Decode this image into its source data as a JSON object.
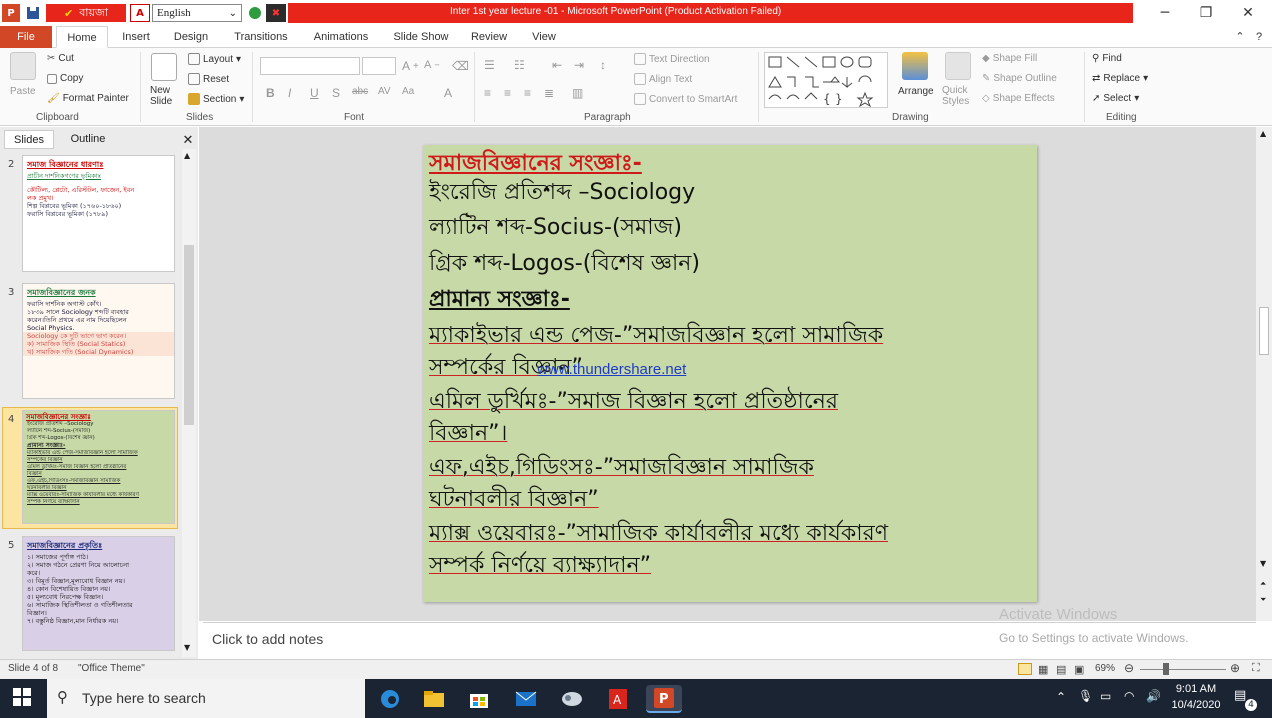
{
  "titlebar": {
    "title": "Inter 1st year lecture -01  -  Microsoft PowerPoint (Product Activation Failed)",
    "language_app": "বায়জা",
    "language_select": "English"
  },
  "tabs": [
    "File",
    "Home",
    "Insert",
    "Design",
    "Transitions",
    "Animations",
    "Slide Show",
    "Review",
    "View"
  ],
  "ribbon": {
    "clipboard": {
      "paste": "Paste",
      "cut": "Cut",
      "copy": "Copy",
      "format_painter": "Format Painter",
      "label": "Clipboard"
    },
    "slides": {
      "new_slide": "New Slide",
      "layout": "Layout",
      "reset": "Reset",
      "section": "Section",
      "label": "Slides"
    },
    "font": {
      "label": "Font"
    },
    "paragraph": {
      "text_direction": "Text Direction",
      "align_text": "Align Text",
      "convert_smartart": "Convert to SmartArt",
      "label": "Paragraph"
    },
    "drawing": {
      "arrange": "Arrange",
      "quick_styles": "Quick Styles",
      "shape_fill": "Shape Fill",
      "shape_outline": "Shape Outline",
      "shape_effects": "Shape Effects",
      "label": "Drawing"
    },
    "editing": {
      "find": "Find",
      "replace": "Replace",
      "select": "Select",
      "label": "Editing"
    }
  },
  "pane": {
    "tab_slides": "Slides",
    "tab_outline": "Outline",
    "thumbs": [
      {
        "num": "2",
        "heading": "সমাজ বিজ্ঞানের ধারণাঃ",
        "lines": [
          "প্রাচীন দার্শনিকগণের ভূমিকাঃ",
          "কৌটিল্য, প্লেটো, এরিস্টটল, ফাজেন, ইবন",
          "লক প্রমুখ।",
          "শিল্প বিপ্লবের ভূমিকা (১৭৬০-১৮৬০)",
          "ফরাসি বিপ্লবের ভূমিকা (১৭৮৯)"
        ]
      },
      {
        "num": "3",
        "heading": "সমাজবিজ্ঞানের জনক",
        "lines": [
          "ফরাসি দার্শনিক অগাস্ট কোঁৎ।",
          "১৮৩৯ সালে Sociology শব্দটি ব্যবহার",
          "করেন।তিনি প্রথমে এর নাম দিয়েছিলেন",
          "Social Physics.",
          "Sociology কে দুটি ভাগে ভাগ করেন।",
          "ক) সামাজিক স্থিতি (Social Statics)",
          "খ) সামাজিক গতি (Social Dynamics)"
        ]
      },
      {
        "num": "4",
        "heading": "সমাজবিজ্ঞানের সংজ্ঞাঃ",
        "lines": [
          "ইংরেজি প্রতিশব্দ –Sociology",
          "ল্যাটিন শব্দ-Socius-(সমাজ)",
          "গ্রিক শব্দ-Logos-(বিশেষ জ্ঞান)",
          "প্রামান্য সংজ্ঞাঃ-",
          "ম্যাকাইভার এন্ড পেজ-সমাজবিজ্ঞান হলো সামাজিক",
          "সম্পর্কের বিজ্ঞান",
          "এমিল ডুর্খিমঃ-সমাজ বিজ্ঞান হলো প্রতিষ্ঠানের",
          "বিজ্ঞান",
          "এফ,এইচ,গিডিংসঃ-সমাজবিজ্ঞান সামাজিক",
          "ঘটনাবলীর বিজ্ঞান",
          "ম্যাক্স ওয়েবারঃ-সামাজিক কার্যাবলীর মধ্যে কার্যকারণ",
          "সম্পর্ক নির্ণয়ে ব্যাক্ষ্যাদান"
        ]
      },
      {
        "num": "5",
        "heading": "সমাজবিজ্ঞানের প্রকৃতিঃ",
        "lines": [
          "১। সমাজের পূর্ণাঙ্গ পাঠ।",
          "২। সমাজ গঠনে প্রেরণা নিয়ে আলোচনা",
          "করে।",
          "৩। বিমূর্ত বিজ্ঞান,মূল্যবোধ বিজ্ঞান নয়।",
          "৪। কোন বিশেষায়িত বিজ্ঞান নয়।",
          "৫। মূল্যবোধ নিরপেক্ষ বিজ্ঞান।",
          "৬। সামাজিক স্থিতিশীলতা ও গতিশীলতার",
          "বিজ্ঞান।",
          "৭। বস্তুনিষ্ঠ বিজ্ঞান,মান নির্ধারক নয়।"
        ]
      }
    ]
  },
  "slide": {
    "lines": [
      {
        "text": "সমাজবিজ্ঞানের সংজ্ঞাঃ-",
        "style": "heading-red"
      },
      {
        "text": "ইংরেজি প্রতিশব্দ –Sociology",
        "style": "plain"
      },
      {
        "text": "ল্যাটিন শব্দ-Socius-(সমাজ)",
        "style": "plain"
      },
      {
        "text": "গ্রিক শব্দ-Logos-(বিশেষ জ্ঞান)",
        "style": "plain"
      },
      {
        "text": "প্রামান্য সংজ্ঞাঃ-",
        "style": "heading"
      },
      {
        "text": "ম্যাকাইভার এন্ড পেজ-”সমাজবিজ্ঞান হলো সামাজিক",
        "style": "underline"
      },
      {
        "text": "সম্পর্কের বিজ্ঞান”",
        "style": "underline"
      },
      {
        "text": "এমিল ডুর্খিমঃ-”সমাজ বিজ্ঞান হলো প্রতিষ্ঠানের",
        "style": "underline"
      },
      {
        "text": "বিজ্ঞান”।",
        "style": "underline"
      },
      {
        "text": "এফ,এইচ,গিডিংসঃ-”সমাজবিজ্ঞান সামাজিক",
        "style": "underline"
      },
      {
        "text": "ঘটনাবলীর বিজ্ঞান”",
        "style": "underline"
      },
      {
        "text": "ম্যাক্স ওয়েবারঃ-”সামাজিক কার্যাবলীর মধ্যে কার্যকারণ",
        "style": "underline"
      },
      {
        "text": "সম্পর্ক নির্ণয়ে ব্যাক্ষ্যাদান”",
        "style": "underline"
      }
    ],
    "watermark": "www.thundershare.net",
    "background": "#c6d9a6"
  },
  "notes": {
    "placeholder": "Click to add notes"
  },
  "activate": {
    "line1": "Activate Windows",
    "line2": "Go to Settings to activate Windows."
  },
  "status": {
    "slide_info": "Slide 4 of 8",
    "theme": "\"Office Theme\"",
    "zoom": "69%"
  },
  "taskbar": {
    "search_placeholder": "Type here to search",
    "time": "9:01 AM",
    "date": "10/4/2020",
    "notifications": "4"
  }
}
